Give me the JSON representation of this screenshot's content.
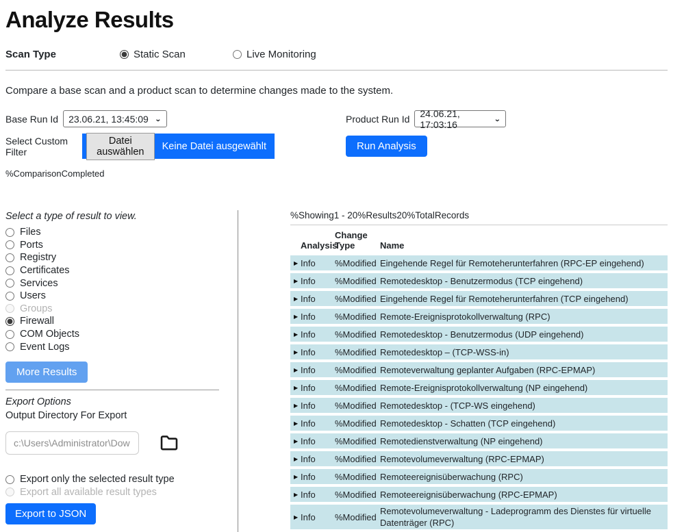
{
  "page": {
    "title": "Analyze Results"
  },
  "scan_type": {
    "label": "Scan Type",
    "options": [
      {
        "label": "Static Scan",
        "selected": true
      },
      {
        "label": "Live Monitoring",
        "selected": false
      }
    ]
  },
  "compare": {
    "description": "Compare a base scan and a product scan to determine changes made to the system.",
    "base_run": {
      "label": "Base Run Id",
      "value": "23.06.21, 13:45:09"
    },
    "product_run": {
      "label": "Product Run Id",
      "value": "24.06.21, 17:03:16"
    },
    "custom_filter": {
      "label": "Select Custom Filter",
      "button": "Datei auswählen",
      "status": "Keine Datei ausgewählt"
    },
    "run_button": "Run Analysis",
    "status": "%ComparisonCompleted"
  },
  "result_types": {
    "prompt": "Select a type of result to view.",
    "options": [
      {
        "label": "Files",
        "selected": false,
        "disabled": false
      },
      {
        "label": "Ports",
        "selected": false,
        "disabled": false
      },
      {
        "label": "Registry",
        "selected": false,
        "disabled": false
      },
      {
        "label": "Certificates",
        "selected": false,
        "disabled": false
      },
      {
        "label": "Services",
        "selected": false,
        "disabled": false
      },
      {
        "label": "Users",
        "selected": false,
        "disabled": false
      },
      {
        "label": "Groups",
        "selected": false,
        "disabled": true
      },
      {
        "label": "Firewall",
        "selected": true,
        "disabled": false
      },
      {
        "label": "COM Objects",
        "selected": false,
        "disabled": false
      },
      {
        "label": "Event Logs",
        "selected": false,
        "disabled": false
      }
    ],
    "more_button": "More Results"
  },
  "export": {
    "heading": "Export Options",
    "output_label": "Output Directory For Export",
    "output_value": "c:\\Users\\Administrator\\Dow",
    "folder_icon": "folder-icon",
    "options": [
      {
        "label": "Export only the selected result type",
        "selected": false,
        "disabled": false
      },
      {
        "label": "Export all available result types",
        "selected": false,
        "disabled": true
      }
    ],
    "button": "Export to JSON"
  },
  "results": {
    "summary": "%Showing1 - 20%Results20%TotalRecords",
    "columns": [
      "Analysis",
      "Change Type",
      "Name"
    ],
    "rows": [
      {
        "analysis": "Info",
        "change": "%Modified",
        "name": "Eingehende Regel für Remoteherunterfahren (RPC-EP eingehend)"
      },
      {
        "analysis": "Info",
        "change": "%Modified",
        "name": "Remotedesktop - Benutzermodus (TCP eingehend)"
      },
      {
        "analysis": "Info",
        "change": "%Modified",
        "name": "Eingehende Regel für Remoteherunterfahren (TCP eingehend)"
      },
      {
        "analysis": "Info",
        "change": "%Modified",
        "name": "Remote-Ereignisprotokollverwaltung (RPC)"
      },
      {
        "analysis": "Info",
        "change": "%Modified",
        "name": "Remotedesktop - Benutzermodus (UDP eingehend)"
      },
      {
        "analysis": "Info",
        "change": "%Modified",
        "name": "Remotedesktop – (TCP-WSS-in)"
      },
      {
        "analysis": "Info",
        "change": "%Modified",
        "name": "Remoteverwaltung geplanter Aufgaben (RPC-EPMAP)"
      },
      {
        "analysis": "Info",
        "change": "%Modified",
        "name": "Remote-Ereignisprotokollverwaltung (NP eingehend)"
      },
      {
        "analysis": "Info",
        "change": "%Modified",
        "name": "Remotedesktop - (TCP-WS eingehend)"
      },
      {
        "analysis": "Info",
        "change": "%Modified",
        "name": "Remotedesktop - Schatten (TCP eingehend)"
      },
      {
        "analysis": "Info",
        "change": "%Modified",
        "name": "Remotedienstverwaltung (NP eingehend)"
      },
      {
        "analysis": "Info",
        "change": "%Modified",
        "name": "Remotevolumeverwaltung (RPC-EPMAP)"
      },
      {
        "analysis": "Info",
        "change": "%Modified",
        "name": "Remoteereignisüberwachung (RPC)"
      },
      {
        "analysis": "Info",
        "change": "%Modified",
        "name": "Remoteereignisüberwachung (RPC-EPMAP)"
      },
      {
        "analysis": "Info",
        "change": "%Modified",
        "name": "Remotevolumeverwaltung - Ladeprogramm des Dienstes für virtuelle Datenträger (RPC)"
      }
    ]
  },
  "colors": {
    "primary": "#0d6efd",
    "secondary": "#62a1f0",
    "rowbg": "#c8e4ea"
  }
}
